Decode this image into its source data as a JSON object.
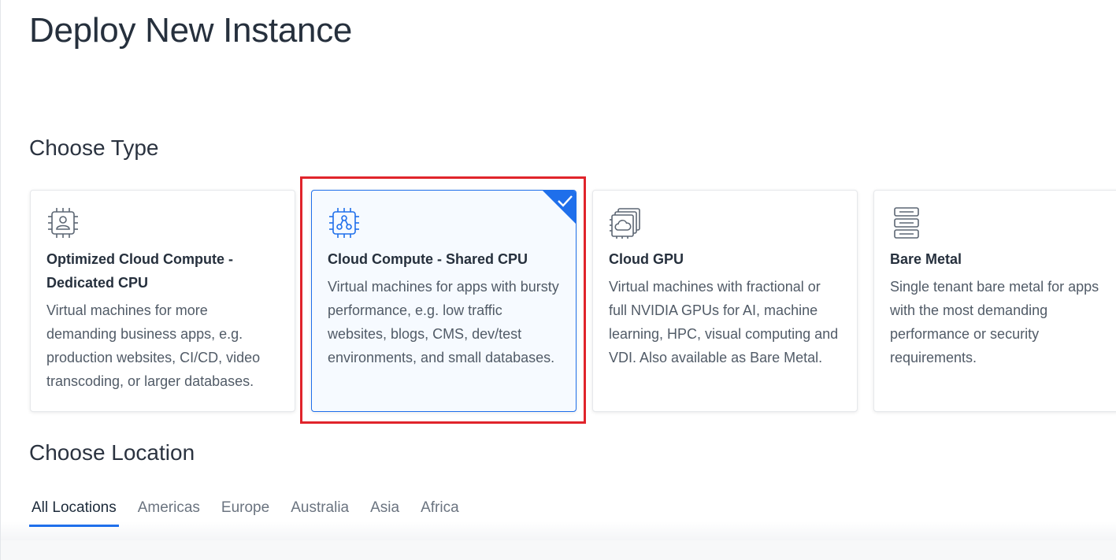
{
  "page": {
    "title": "Deploy New Instance"
  },
  "choose_type": {
    "heading": "Choose Type",
    "cards": [
      {
        "icon": "cpu-user-icon",
        "title": "Optimized Cloud Compute - Dedicated CPU",
        "description": "Virtual machines for more demanding business apps, e.g. production websites, CI/CD, video transcoding, or larger databases.",
        "selected": false
      },
      {
        "icon": "cpu-share-icon",
        "title": "Cloud Compute - Shared CPU",
        "description": "Virtual machines for apps with bursty performance, e.g. low traffic websites, blogs, CMS, dev/test environments, and small databases.",
        "selected": true
      },
      {
        "icon": "gpu-cloud-icon",
        "title": "Cloud GPU",
        "description": "Virtual machines with fractional or full NVIDIA GPUs for AI, machine learning, HPC, visual computing and VDI. Also available as Bare Metal.",
        "selected": false
      },
      {
        "icon": "server-rack-icon",
        "title": "Bare Metal",
        "description": "Single tenant bare metal for apps with the most demanding performance or security requirements.",
        "selected": false
      }
    ]
  },
  "choose_location": {
    "heading": "Choose Location",
    "tabs": [
      {
        "label": "All Locations",
        "active": true
      },
      {
        "label": "Americas",
        "active": false
      },
      {
        "label": "Europe",
        "active": false
      },
      {
        "label": "Australia",
        "active": false
      },
      {
        "label": "Asia",
        "active": false
      },
      {
        "label": "Africa",
        "active": false
      }
    ]
  },
  "colors": {
    "accent": "#1f6feb",
    "highlight": "#e0242b",
    "icon_selected": "#1f6feb",
    "icon_default": "#5c6673"
  }
}
